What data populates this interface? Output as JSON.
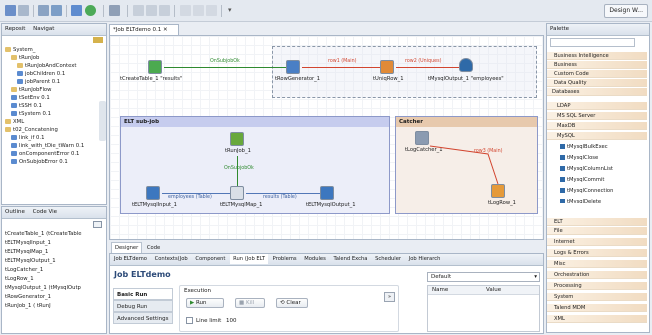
{
  "toolbar": {
    "perspective_label": "Design W..."
  },
  "repository": {
    "tabs": [
      "Reposit",
      "Navigat"
    ],
    "items": [
      "System_",
      "tRunJob",
      "tRunJobAndContext",
      "jobChildren 0.1",
      "jobParent 0.1",
      "tRunJobFlow",
      "tSetEnv 0.1",
      "tSSH 0.1",
      "tSystem 0.1",
      "XML",
      "t02_Concatening",
      "link_if 0.1",
      "link_with_tDie_tWarn 0.1",
      "onComponentError 0.1",
      "OnSubjobError 0.1"
    ]
  },
  "outline": {
    "tabs": [
      "Outline",
      "Code Vie"
    ],
    "items": [
      "tCreateTable_1 (tCreateTable",
      "tELTMysqlInput_1",
      "tELTMysqlMap_1",
      "tELTMysqlOutput_1",
      "tLogCatcher_1",
      "tLogRow_1",
      "tMysqlOutput_1 (tMysqlOutp",
      "tRowGenerator_1",
      "tRunJob_1 (   tRunJ"
    ]
  },
  "editor": {
    "tab": "*Job ELTdemo 0.1",
    "subjob_elt": "ELT sub-job",
    "subjob_catcher": "Catcher",
    "comp": {
      "create": "tCreateTable_1 \"results\"",
      "rowgen": "tRowGenerator_1",
      "uniq": "tUniqRow_1",
      "mysqlout": "tMysqlOutput_1 \"employees\"",
      "runjob": "tRunJob_1",
      "eltin": "tELTMysqlInput_1",
      "eltmap": "tELTMysqlMap_1",
      "eltout": "tELTMysqlOutput_1",
      "logcatcher": "tLogCatcher_1",
      "logrow": "tLogRow_1"
    },
    "links": {
      "onsubjobok1": "OnSubjobOk",
      "row1": "row1 (Main)",
      "row2": "row2 (Uniques)",
      "onsubjobok2": "OnSubjobOk",
      "employees": "employees (Table)",
      "results": "results (Table)",
      "row3": "row3 (Main)"
    },
    "bottom_tabs": [
      "Designer",
      "Code"
    ]
  },
  "palette": {
    "title": "Palette",
    "categories_top": [
      "Business Intelligence",
      "Business",
      "Custom Code",
      "Data Quality",
      "Databases"
    ],
    "db_sub": [
      "LDAP",
      "MS SQL Server",
      "MaxDB",
      "MySQL"
    ],
    "mysql_items": [
      "tMysqlBulkExec",
      "tMysqlClose",
      "tMysqlColumnList",
      "tMysqlCommit",
      "tMysqlConnection",
      "tMysqlDelete"
    ],
    "categories_bottom": [
      "ELT",
      "File",
      "Internet",
      "Logs & Errors",
      "Misc",
      "Orchestration",
      "Processing",
      "System",
      "Talend MDM",
      "XML"
    ]
  },
  "bottom": {
    "tabs": [
      "Job ELTdemo",
      "Contexts(Job",
      "Component",
      "Run (Job ELT",
      "Problems",
      "Modules",
      "Talend Excha",
      "Scheduler",
      "Job Hierarch"
    ],
    "job_title": "Job ELTdemo",
    "side_tabs": [
      "Basic Run",
      "Debug Run",
      "Advanced Settings"
    ],
    "execution_label": "Execution",
    "run_label": "Run",
    "kill_label": "Kill",
    "clear_label": "Clear",
    "line_limit_label": "Line limit",
    "line_limit_value": "100",
    "context_value": "Default",
    "table_headers": [
      "Name",
      "Value"
    ]
  }
}
